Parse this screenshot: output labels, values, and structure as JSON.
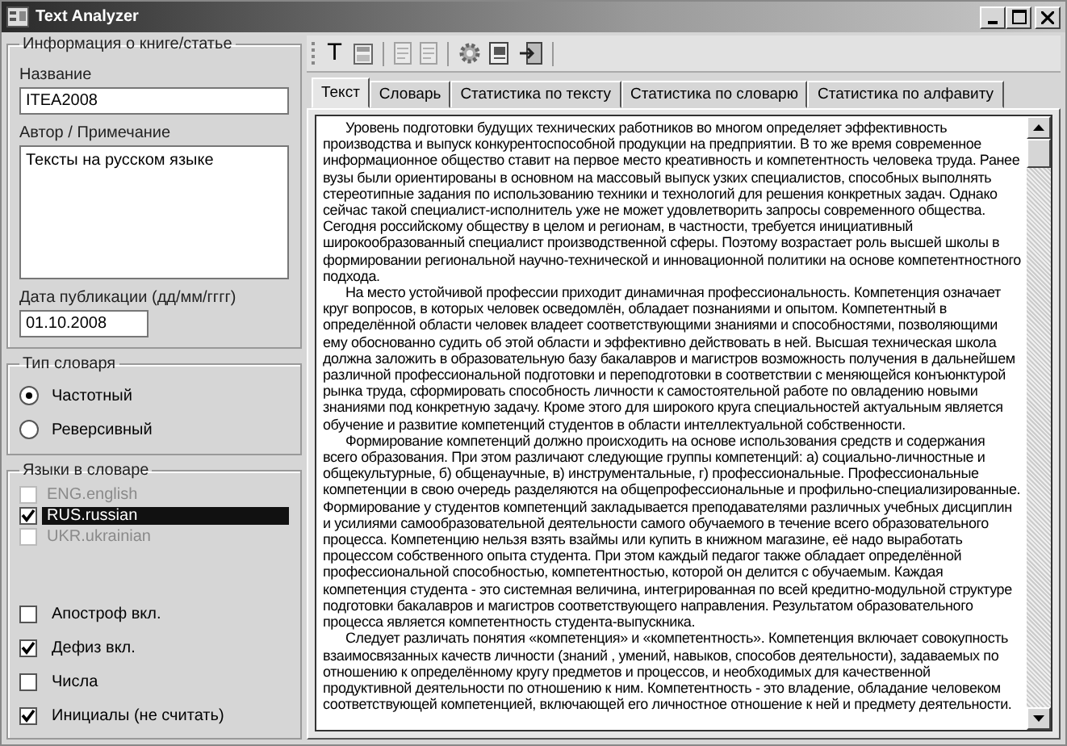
{
  "window": {
    "title": "Text Analyzer"
  },
  "book_info": {
    "legend": "Информация о книге/статье",
    "title_label": "Название",
    "title_value": "ITEA2008",
    "author_label": "Автор / Примечание",
    "author_value": "Тексты на русском языке",
    "date_label": "Дата публикации (дд/мм/гггг)",
    "date_value": "01.10.2008"
  },
  "dictionary_type": {
    "legend": "Тип словаря",
    "options": [
      {
        "label": "Частотный",
        "selected": true
      },
      {
        "label": "Реверсивный",
        "selected": false
      }
    ]
  },
  "languages": {
    "legend": "Языки в словаре",
    "items": [
      {
        "label": "ENG.english",
        "checked": false,
        "disabled": true,
        "selected": false
      },
      {
        "label": "RUS.russian",
        "checked": true,
        "disabled": false,
        "selected": true
      },
      {
        "label": "UKR.ukrainian",
        "checked": false,
        "disabled": true,
        "selected": false
      }
    ]
  },
  "options": [
    {
      "label": "Апостроф вкл.",
      "checked": false
    },
    {
      "label": "Дефиз вкл.",
      "checked": true
    },
    {
      "label": "Числа",
      "checked": false
    },
    {
      "label": "Инициалы (не считать)",
      "checked": true
    }
  ],
  "toolbar": [
    {
      "kind": "glyph",
      "label": "T",
      "disabled": false
    },
    {
      "kind": "calculator",
      "disabled": false
    },
    {
      "kind": "separator"
    },
    {
      "kind": "document",
      "disabled": true
    },
    {
      "kind": "document",
      "disabled": true
    },
    {
      "kind": "separator"
    },
    {
      "kind": "gear",
      "disabled": false
    },
    {
      "kind": "report",
      "disabled": false
    },
    {
      "kind": "exit",
      "disabled": false
    },
    {
      "kind": "separator"
    }
  ],
  "tabs": [
    {
      "label": "Текст",
      "selected": true
    },
    {
      "label": "Словарь",
      "selected": false
    },
    {
      "label": "Статистика по тексту",
      "selected": false
    },
    {
      "label": "Статистика по словарю",
      "selected": false
    },
    {
      "label": "Статистика по алфавиту",
      "selected": false
    }
  ],
  "text_paragraphs": [
    "Уровень подготовки будущих технических работников во многом определяет эффективность производства и выпуск конкурентоспособной продукции на предприятии. В то же время современное информационное общество ставит на первое место креативность и компетентность человека труда. Ранее вузы были ориентированы в основном на массовый выпуск узких специалистов, способных выполнять стереотипные задания по использованию техники и технологий для решения конкретных задач. Однако сейчас такой специалист-исполнитель уже не может удовлетворить запросы современного общества. Сегодня российскому обществу в целом и регионам, в частности, требуется инициативный широкообразованный специалист производственной сферы. Поэтому возрастает роль высшей школы в формировании региональной научно-технической и инновационной политики на основе компетентностного подхода.",
    "На место устойчивой профессии приходит динамичная профессиональность. Компетенция означает круг вопросов, в которых человек осведомлён, обладает познаниями и опытом. Компетентный в определённой области человек владеет соответствующими знаниями и способностями, позволяющими ему обоснованно судить об этой области и эффективно действовать в ней. Высшая техническая школа должна заложить в образовательную базу бакалавров и магистров возможность получения в дальнейшем различной профессиональной подготовки и переподготовки в соответствии с меняющейся конъюнктурой рынка труда, сформировать способность личности к самостоятельной  работе по овладению новыми знаниями под конкретную задачу. Кроме этого для широкого круга специальностей актуальным является обучение и развитие компетенций студентов в области интеллектуальной собственности.",
    "Формирование компетенций должно происходить на основе использования средств и содержания всего образования. При этом различают следующие группы компетенций: а) социально-личностные и общекультурные, б) общенаучные, в) инструментальные, г) профессиональные. Профессиональные компетенции в свою очередь разделяются на общепрофессиональные и профильно-специализированные. Формирование у студентов компетенций закладывается преподавателями различных учебных дисциплин и усилиями самообразовательной деятельности самого обучаемого в течение всего образовательного процесса. Компетенцию нельзя взять взаймы или купить в книжном магазине, её надо выработать процессом собственного опыта студента. При этом каждый педагог также обладает определённой профессиональной способностью, компетентностью, которой он делится с обучаемым. Каждая компетенция студента - это системная величина, интегрированная по всей кредитно-модульной структуре подготовки бакалавров и магистров соответствующего направления. Результатом образовательного процесса является компетентность студента-выпускника.",
    "Следует различать понятия «компетенция» и «компетентность». Компетенция включает совокупность взаимосвязанных качеств личности (знаний , умений, навыков, способов деятельности), задаваемых по отношению к определённому кругу предметов и процессов, и необходимых для качественной продуктивной деятельности по отношению к ним. Компетентность - это владение, обладание человеком соответствующей компетенцией, включающей его личностное отношение к ней и предмету деятельности."
  ]
}
